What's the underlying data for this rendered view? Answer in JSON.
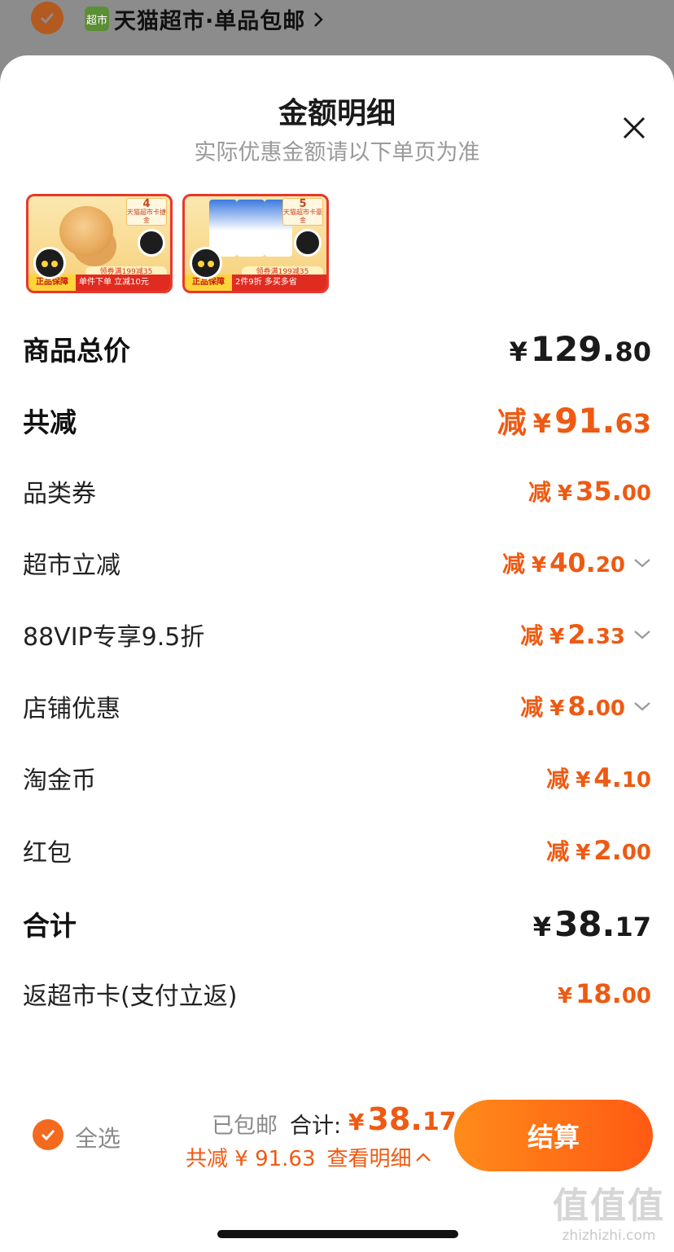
{
  "background": {
    "store_title": "天猫超市·单品包邮",
    "store_logo_text": "超市"
  },
  "modal": {
    "title": "金额明细",
    "subtitle": "实际优惠金额请以下单页为准"
  },
  "thumbnails": [
    {
      "card_number": "4",
      "card_text": "天猫超市卡捷金",
      "coupon": "领券满199减35",
      "badge": "正品保障",
      "footer": "单件下单 立减10元"
    },
    {
      "card_number": "5",
      "card_text": "天猫超市卡豪金",
      "coupon": "领券满199减35",
      "badge": "正品保障",
      "footer": "2件9折 多买多省"
    }
  ],
  "rows": {
    "subtotal": {
      "label": "商品总价",
      "yen": "¥",
      "int": "129.",
      "dec": "80"
    },
    "total_discount": {
      "label": "共减",
      "prefix": "减",
      "yen": "¥",
      "int": "91.",
      "dec": "63"
    },
    "category_coupon": {
      "label": "品类券",
      "prefix": "减",
      "yen": "¥",
      "int": "35.",
      "dec": "00"
    },
    "supermarket_discount": {
      "label": "超市立减",
      "prefix": "减",
      "yen": "¥",
      "int": "40.",
      "dec": "20"
    },
    "vip_discount": {
      "label": "88VIP专享9.5折",
      "prefix": "减",
      "yen": "¥",
      "int": "2.",
      "dec": "33"
    },
    "store_discount": {
      "label": "店铺优惠",
      "prefix": "减",
      "yen": "¥",
      "int": "8.",
      "dec": "00"
    },
    "tao_coins": {
      "label": "淘金币",
      "prefix": "减",
      "yen": "¥",
      "int": "4.",
      "dec": "10"
    },
    "red_packet": {
      "label": "红包",
      "prefix": "减",
      "yen": "¥",
      "int": "2.",
      "dec": "00"
    },
    "grand_total": {
      "label": "合计",
      "yen": "¥",
      "int": "38.",
      "dec": "17"
    },
    "cashback": {
      "label": "返超市卡(支付立返)",
      "yen": "¥",
      "int": "18.",
      "dec": "00"
    }
  },
  "bottom_bar": {
    "select_all": "全选",
    "shipping": "已包邮",
    "total_label": "合计:",
    "total_yen": "¥",
    "total_int": "38.",
    "total_dec": "17",
    "saving_text": "共减 ¥ 91.63",
    "detail_link": "查看明细",
    "checkout": "结算"
  },
  "watermark": {
    "mark": "值值值",
    "url": "zhizhizhi.com"
  },
  "colors": {
    "accent": "#ee5a13",
    "checkout_gradient_start": "#ff8b1a",
    "checkout_gradient_end": "#ff5a13",
    "overlay": "#8c8c8c"
  },
  "icons": [
    "check-icon",
    "chevron-right-icon",
    "close-icon",
    "chevron-down-icon",
    "chevron-up-icon"
  ]
}
